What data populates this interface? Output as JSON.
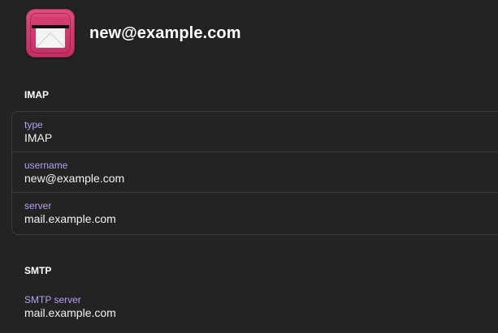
{
  "header": {
    "account_title": "new@example.com",
    "icon": "mail-app-icon"
  },
  "imap": {
    "section_title": "IMAP",
    "rows": [
      {
        "label": "type",
        "value": "IMAP"
      },
      {
        "label": "username",
        "value": "new@example.com"
      },
      {
        "label": "server",
        "value": "mail.example.com"
      }
    ]
  },
  "smtp": {
    "section_title": "SMTP",
    "rows": [
      {
        "label": "SMTP server",
        "value": "mail.example.com"
      }
    ]
  },
  "colors": {
    "background": "#232323",
    "label_accent": "#b6a0f0",
    "icon_accent": "#d43b70"
  }
}
